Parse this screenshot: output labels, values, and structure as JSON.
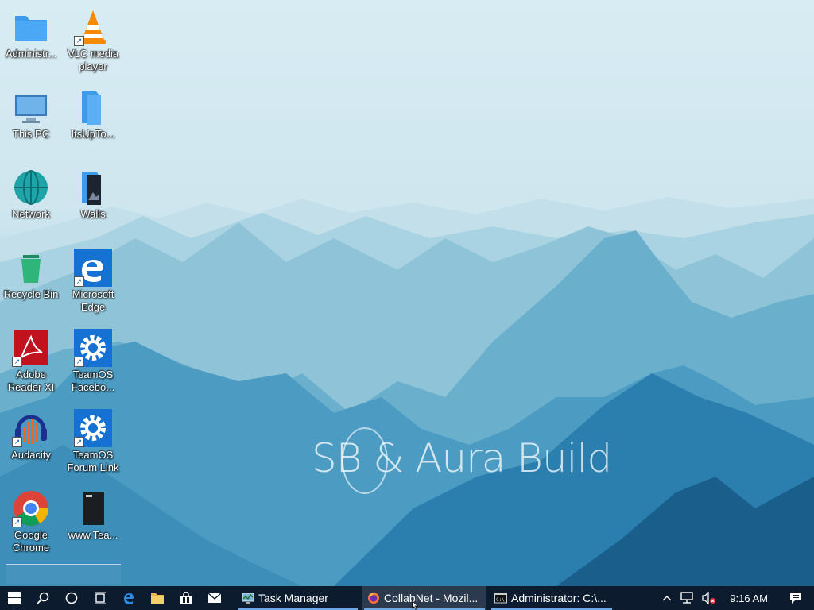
{
  "desktop": {
    "wallpaper_text": "SB & Aura Build",
    "icons": [
      {
        "label": "Administr...",
        "icon": "folder-icon"
      },
      {
        "label": "VLC media player",
        "icon": "vlc-icon"
      },
      {
        "label": "This PC",
        "icon": "monitor-icon"
      },
      {
        "label": "ItsUpTo...",
        "icon": "folder-icon"
      },
      {
        "label": "Network",
        "icon": "globe-icon"
      },
      {
        "label": "Walls",
        "icon": "folder-icon"
      },
      {
        "label": "Recycle Bin",
        "icon": "recycle-bin-icon"
      },
      {
        "label": "Microsoft Edge",
        "icon": "edge-icon"
      },
      {
        "label": "Adobe Reader XI",
        "icon": "adobe-reader-icon"
      },
      {
        "label": "TeamOS Facebo...",
        "icon": "gear-icon"
      },
      {
        "label": "Audacity",
        "icon": "audacity-icon"
      },
      {
        "label": "TeamOS Forum Link",
        "icon": "gear-icon"
      },
      {
        "label": "Google Chrome",
        "icon": "chrome-icon"
      },
      {
        "label": "www.Tea...",
        "icon": "document-icon"
      }
    ]
  },
  "taskbar": {
    "pinned": [
      "start-icon",
      "search-icon",
      "cortana-icon",
      "task-view-icon",
      "edge-icon",
      "file-explorer-icon",
      "store-icon",
      "mail-icon"
    ],
    "tasks": [
      {
        "label": "Task Manager",
        "icon": "task-manager-icon"
      },
      {
        "label": "CollabNet - Mozil...",
        "icon": "firefox-icon"
      },
      {
        "label": "Administrator: C:\\...",
        "icon": "cmd-icon"
      }
    ],
    "tray": {
      "clock": "9:16 AM"
    }
  },
  "colors": {
    "taskbar_bg": "#0c1b2e",
    "accent": "#6aa9e8"
  }
}
